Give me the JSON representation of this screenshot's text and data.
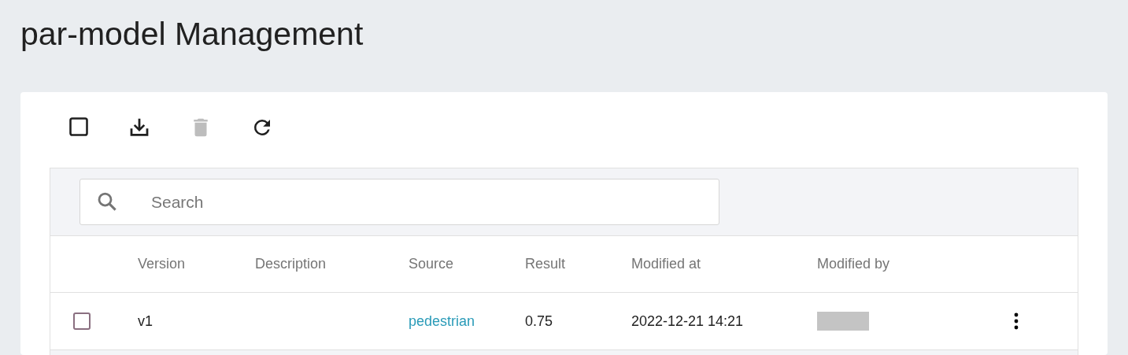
{
  "page": {
    "title": "par-model Management"
  },
  "toolbar": [
    {
      "kind": "select-all",
      "disabled": false
    },
    {
      "kind": "download",
      "disabled": false
    },
    {
      "kind": "delete",
      "disabled": true
    },
    {
      "kind": "refresh",
      "disabled": false
    }
  ],
  "search": {
    "placeholder": "Search"
  },
  "table": {
    "columns": [
      "Version",
      "Description",
      "Source",
      "Result",
      "Modified at",
      "Modified by"
    ],
    "rows": [
      {
        "checked": false,
        "version": "v1",
        "source": "pedestrian",
        "result": "0.75",
        "modified_at": "2022-12-21 14:21",
        "modified_by_redacted": true
      }
    ]
  }
}
